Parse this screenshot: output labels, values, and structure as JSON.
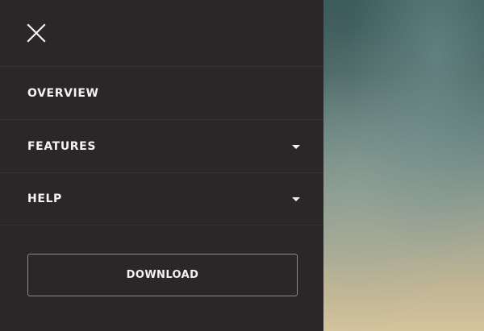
{
  "menu": {
    "close_icon": "close-icon",
    "items": [
      {
        "label": "OVERVIEW",
        "has_dropdown": false
      },
      {
        "label": "FEATURES",
        "has_dropdown": true
      },
      {
        "label": "HELP",
        "has_dropdown": true
      }
    ],
    "download_label": "DOWNLOAD"
  },
  "colors": {
    "panel_background": "#2a2729",
    "text": "#f4f2f3",
    "divider": "#343133",
    "button_border": "#8e8a8c"
  }
}
